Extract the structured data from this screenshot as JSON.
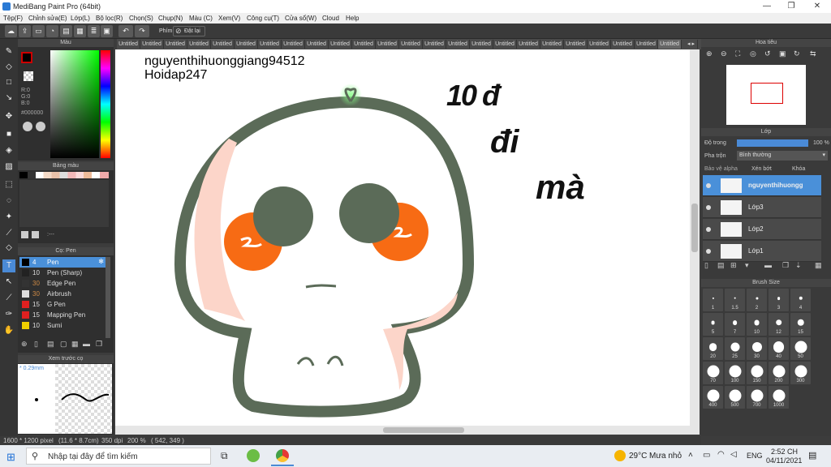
{
  "window": {
    "title": "MediBang Paint Pro (64bit)"
  },
  "menu": [
    "Tệp(F)",
    "Chỉnh sửa(E)",
    "Lớp(L)",
    "Bộ lọc(R)",
    "Chọn(S)",
    "Chụp(N)",
    "Màu (C)",
    "Xem(V)",
    "Công cụ(T)",
    "Cửa sổ(W)",
    "Cloud",
    "Help"
  ],
  "toolbar": {
    "phim_label": "Phím",
    "reset_label": "Đặt lại"
  },
  "tabs": {
    "label": "Untitled",
    "count": 24
  },
  "color_panel": {
    "title": "Màu",
    "r": "R:0",
    "g": "G:0",
    "b": "B:0",
    "hex": "#000000"
  },
  "palette_panel": {
    "title": "Bảng màu",
    "footer": ":---"
  },
  "brush_panel": {
    "title": "Cọ: Pen",
    "items": [
      {
        "size": "4",
        "name": "Pen",
        "color": "#000000"
      },
      {
        "size": "10",
        "name": "Pen (Sharp)",
        "color": "#222222"
      },
      {
        "size": "30",
        "name": "Edge Pen",
        "color": "#333333"
      },
      {
        "size": "30",
        "name": "Airbrush",
        "color": "#dddddd"
      },
      {
        "size": "15",
        "name": "G Pen",
        "color": "#e02020"
      },
      {
        "size": "15",
        "name": "Mapping Pen",
        "color": "#e02020"
      },
      {
        "size": "10",
        "name": "Sumi",
        "color": "#f0d000"
      }
    ]
  },
  "preview_panel": {
    "title": "Xem trước cọ",
    "size": "* 0.29mm"
  },
  "canvas": {
    "text1": "nguyenthihuonggiang94512",
    "text2": "Hoidap247",
    "text3": "10 đ",
    "text4": "đi",
    "text5": "mà"
  },
  "status": {
    "size": "1600 * 1200 pixel",
    "cm": "(11.6 * 8.7cm)",
    "dpi": "350 dpi",
    "zoom": "200 %",
    "coords": "( 542, 349 )"
  },
  "navigator": {
    "title": "Hoa tiêu"
  },
  "layer_panel": {
    "title": "Lớp",
    "opacity_label": "Độ trong",
    "opacity_value": "100 %",
    "opacity_fraction": 1.0,
    "blend_label": "Pha trộn",
    "blend_value": "Bình thường",
    "protect_alpha": "Bảo vệ alpha",
    "clipping": "Xén bớt",
    "lock": "Khóa",
    "layers": [
      "nguyenthihuongg",
      "Lớp3",
      "Lớp2",
      "Lớp1"
    ]
  },
  "brush_size": {
    "title": "Brush Size",
    "sizes": [
      "1",
      "1.5",
      "2",
      "3",
      "4",
      "5",
      "7",
      "10",
      "12",
      "15",
      "20",
      "25",
      "30",
      "40",
      "50",
      "70",
      "100",
      "150",
      "200",
      "300",
      "400",
      "500",
      "700",
      "1000"
    ]
  },
  "taskbar": {
    "search": "Nhập tại đây để tìm kiếm",
    "temp": "29°C",
    "weather": "Mưa nhỏ",
    "lang": "ENG",
    "time": "2:52 CH",
    "date": "04/11/2021"
  },
  "colors": {
    "skull_outline": "#5b6b58",
    "cheek": "#f76b14",
    "shadow": "#fcd5c9",
    "accent": "#4a90d9"
  }
}
